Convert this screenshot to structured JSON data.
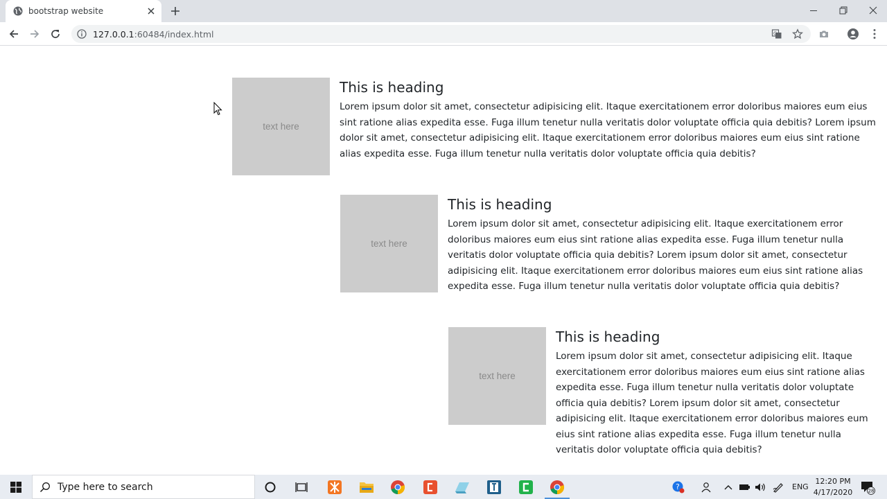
{
  "browser": {
    "tab_title": "bootstrap website",
    "url_host": "127.0.0.1",
    "url_path": ":60484/index.html"
  },
  "media_items": [
    {
      "thumb_text": "text here",
      "heading": "This is heading",
      "body": "Lorem ipsum dolor sit amet, consectetur adipisicing elit. Itaque exercitationem error doloribus maiores eum eius sint ratione alias expedita esse. Fuga illum tenetur nulla veritatis dolor voluptate officia quia debitis? Lorem ipsum dolor sit amet, consectetur adipisicing elit. Itaque exercitationem error doloribus maiores eum eius sint ratione alias expedita esse. Fuga illum tenetur nulla veritatis dolor voluptate officia quia debitis?"
    },
    {
      "thumb_text": "text here",
      "heading": "This is heading",
      "body": "Lorem ipsum dolor sit amet, consectetur adipisicing elit. Itaque exercitationem error doloribus maiores eum eius sint ratione alias expedita esse. Fuga illum tenetur nulla veritatis dolor voluptate officia quia debitis? Lorem ipsum dolor sit amet, consectetur adipisicing elit. Itaque exercitationem error doloribus maiores eum eius sint ratione alias expedita esse. Fuga illum tenetur nulla veritatis dolor voluptate officia quia debitis?"
    },
    {
      "thumb_text": "text here",
      "heading": "This is heading",
      "body": "Lorem ipsum dolor sit amet, consectetur adipisicing elit. Itaque exercitationem error doloribus maiores eum eius sint ratione alias expedita esse. Fuga illum tenetur nulla veritatis dolor voluptate officia quia debitis? Lorem ipsum dolor sit amet, consectetur adipisicing elit. Itaque exercitationem error doloribus maiores eum eius sint ratione alias expedita esse. Fuga illum tenetur nulla veritatis dolor voluptate officia quia debitis?"
    }
  ],
  "taskbar": {
    "search_placeholder": "Type here to search",
    "language": "ENG",
    "time": "12:20 PM",
    "date": "4/17/2020",
    "notification_count": "28",
    "apps": [
      "cortana-circle-icon",
      "task-view-icon",
      "xampp-icon",
      "file-explorer-icon",
      "chrome-icon",
      "brackets-editor-icon",
      "sketch-app-icon",
      "terminal-app-icon",
      "green-editor-icon",
      "chrome-active-icon"
    ]
  },
  "colors": {
    "tabstrip": "#dee1e6",
    "omnibox": "#f1f3f4",
    "placeholder_box": "#cccccc",
    "taskbar": "#e8ecf2"
  }
}
